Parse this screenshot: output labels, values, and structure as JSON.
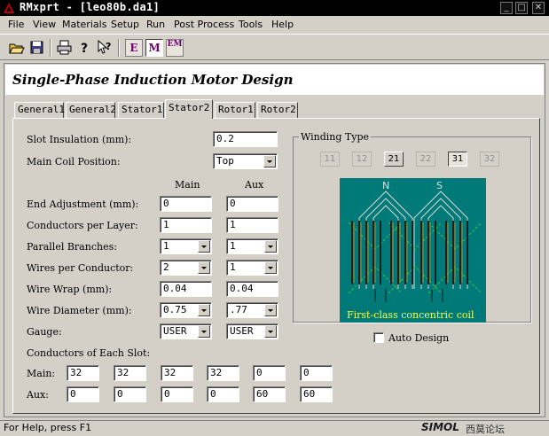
{
  "window": {
    "title": "RMxprt - [leo80b.da1]",
    "minimize": "_",
    "maximize": "□",
    "close": "✕"
  },
  "menu": [
    "File",
    "View",
    "Materials",
    "Setup",
    "Run",
    "Post Process",
    "Tools",
    "Help"
  ],
  "toolbar": {
    "btn_e": "E",
    "btn_m": "M",
    "btn_em": "EM"
  },
  "header": {
    "title": "Single-Phase Induction Motor Design"
  },
  "tabs": [
    "General1",
    "General2",
    "Stator1",
    "Stator2",
    "Rotor1",
    "Rotor2"
  ],
  "active_tab": "Stator2",
  "form": {
    "slot_insulation_label": "Slot Insulation  (mm):",
    "slot_insulation_value": "0.2",
    "main_coil_position_label": "Main Coil Position:",
    "main_coil_position_value": "Top",
    "col_main": "Main",
    "col_aux": "Aux",
    "rows": [
      {
        "label": "End Adjustment  (mm):",
        "main": "0",
        "aux": "0"
      },
      {
        "label": "Conductors per Layer:",
        "main": "1",
        "aux": "1"
      },
      {
        "label": "Parallel Branches:",
        "main": "1",
        "aux": "1"
      },
      {
        "label": "Wires per Conductor:",
        "main": "2",
        "aux": "1"
      },
      {
        "label": "Wire Wrap  (mm):",
        "main": "0.04",
        "aux": "0.04"
      },
      {
        "label": "Wire Diameter  (mm):",
        "main": "0.75",
        "aux": ".77"
      },
      {
        "label": "Gauge:",
        "main": "USER",
        "aux": "USER"
      }
    ],
    "conductors_label": "Conductors of Each Slot:",
    "main_label": "Main:",
    "aux_label": "Aux:",
    "slot_main": [
      "32",
      "32",
      "32",
      "32",
      "0",
      "0"
    ],
    "slot_aux": [
      "0",
      "0",
      "0",
      "0",
      "60",
      "60"
    ]
  },
  "winding": {
    "title": "Winding Type",
    "buttons": [
      {
        "label": "11",
        "state": "disabled"
      },
      {
        "label": "12",
        "state": "disabled"
      },
      {
        "label": "21",
        "state": "enabled"
      },
      {
        "label": "22",
        "state": "disabled"
      },
      {
        "label": "31",
        "state": "selected"
      },
      {
        "label": "32",
        "state": "disabled"
      }
    ],
    "pole_n": "N",
    "pole_s": "S",
    "caption": "First-class concentric coil",
    "auto_design_label": "Auto Design",
    "auto_design_checked": false
  },
  "status": {
    "text": "For Help, press F1",
    "watermark_main": "SIMOL",
    "watermark_sub": "西莫论坛"
  },
  "colors": {
    "coil_bg": "#007a78",
    "caption": "#ffff40",
    "accent": "#700070"
  }
}
